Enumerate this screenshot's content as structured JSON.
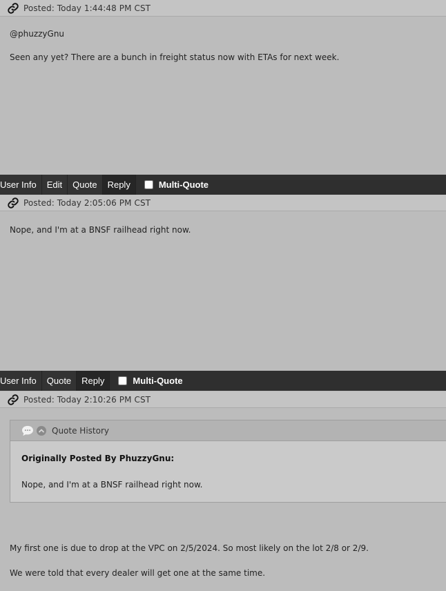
{
  "posts": [
    {
      "posted": "Posted: Today 1:44:48 PM CST",
      "lines": [
        "@phuzzyGnu",
        "Seen any yet?  There are a bunch in freight status now with ETAs for next week."
      ]
    },
    {
      "posted": "Posted: Today 2:05:06 PM CST",
      "lines": [
        "Nope, and I'm at a BNSF railhead right now."
      ]
    },
    {
      "posted": "Posted: Today 2:10:26 PM CST",
      "quote": {
        "header": "Quote History",
        "by": "Originally Posted By PhuzzyGnu:",
        "text": "Nope, and I'm at a BNSF railhead right now."
      },
      "lines": [
        "My first one is due to drop at the VPC on 2/5/2024.  So most likely on the lot 2/8 or 2/9.",
        "We were told that every dealer will get one at the same time."
      ]
    }
  ],
  "toolbars": [
    {
      "buttons": [
        "User Info",
        "Edit",
        "Quote",
        "Reply"
      ],
      "multiquote": "Multi-Quote"
    },
    {
      "buttons": [
        "User Info",
        "Quote",
        "Reply"
      ],
      "multiquote": "Multi-Quote"
    }
  ],
  "icons": {
    "link": "link-icon",
    "bubble": "speech-bubble-icon",
    "collapse": "chevron-up-icon"
  }
}
